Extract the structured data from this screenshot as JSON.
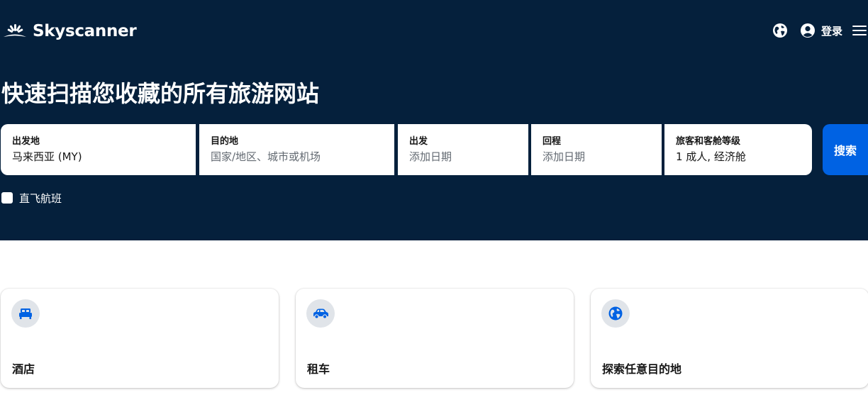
{
  "header": {
    "brand": "Skyscanner",
    "login_label": "登录",
    "icons": {
      "globe": "globe-icon",
      "account": "account-icon",
      "menu": "hamburger-menu-icon"
    }
  },
  "hero": {
    "headline": "快速扫描您收藏的所有旅游网站",
    "background_color": "#05203c"
  },
  "search": {
    "origin": {
      "label": "出发地",
      "value": "马来西亚 (MY)"
    },
    "destination": {
      "label": "目的地",
      "placeholder": "国家/地区、城市或机场"
    },
    "depart": {
      "label": "出发",
      "placeholder": "添加日期"
    },
    "return": {
      "label": "回程",
      "placeholder": "添加日期"
    },
    "travellers": {
      "label": "旅客和客舱等级",
      "value": "1 成人, 经济舱"
    },
    "search_button": "搜索",
    "accent_color": "#0062e3"
  },
  "direct_flights": {
    "label": "直飞航班",
    "checked": false
  },
  "cards": [
    {
      "title": "酒店",
      "icon": "bed-icon"
    },
    {
      "title": "租车",
      "icon": "car-icon"
    },
    {
      "title": "探索任意目的地",
      "icon": "globe-icon"
    }
  ]
}
